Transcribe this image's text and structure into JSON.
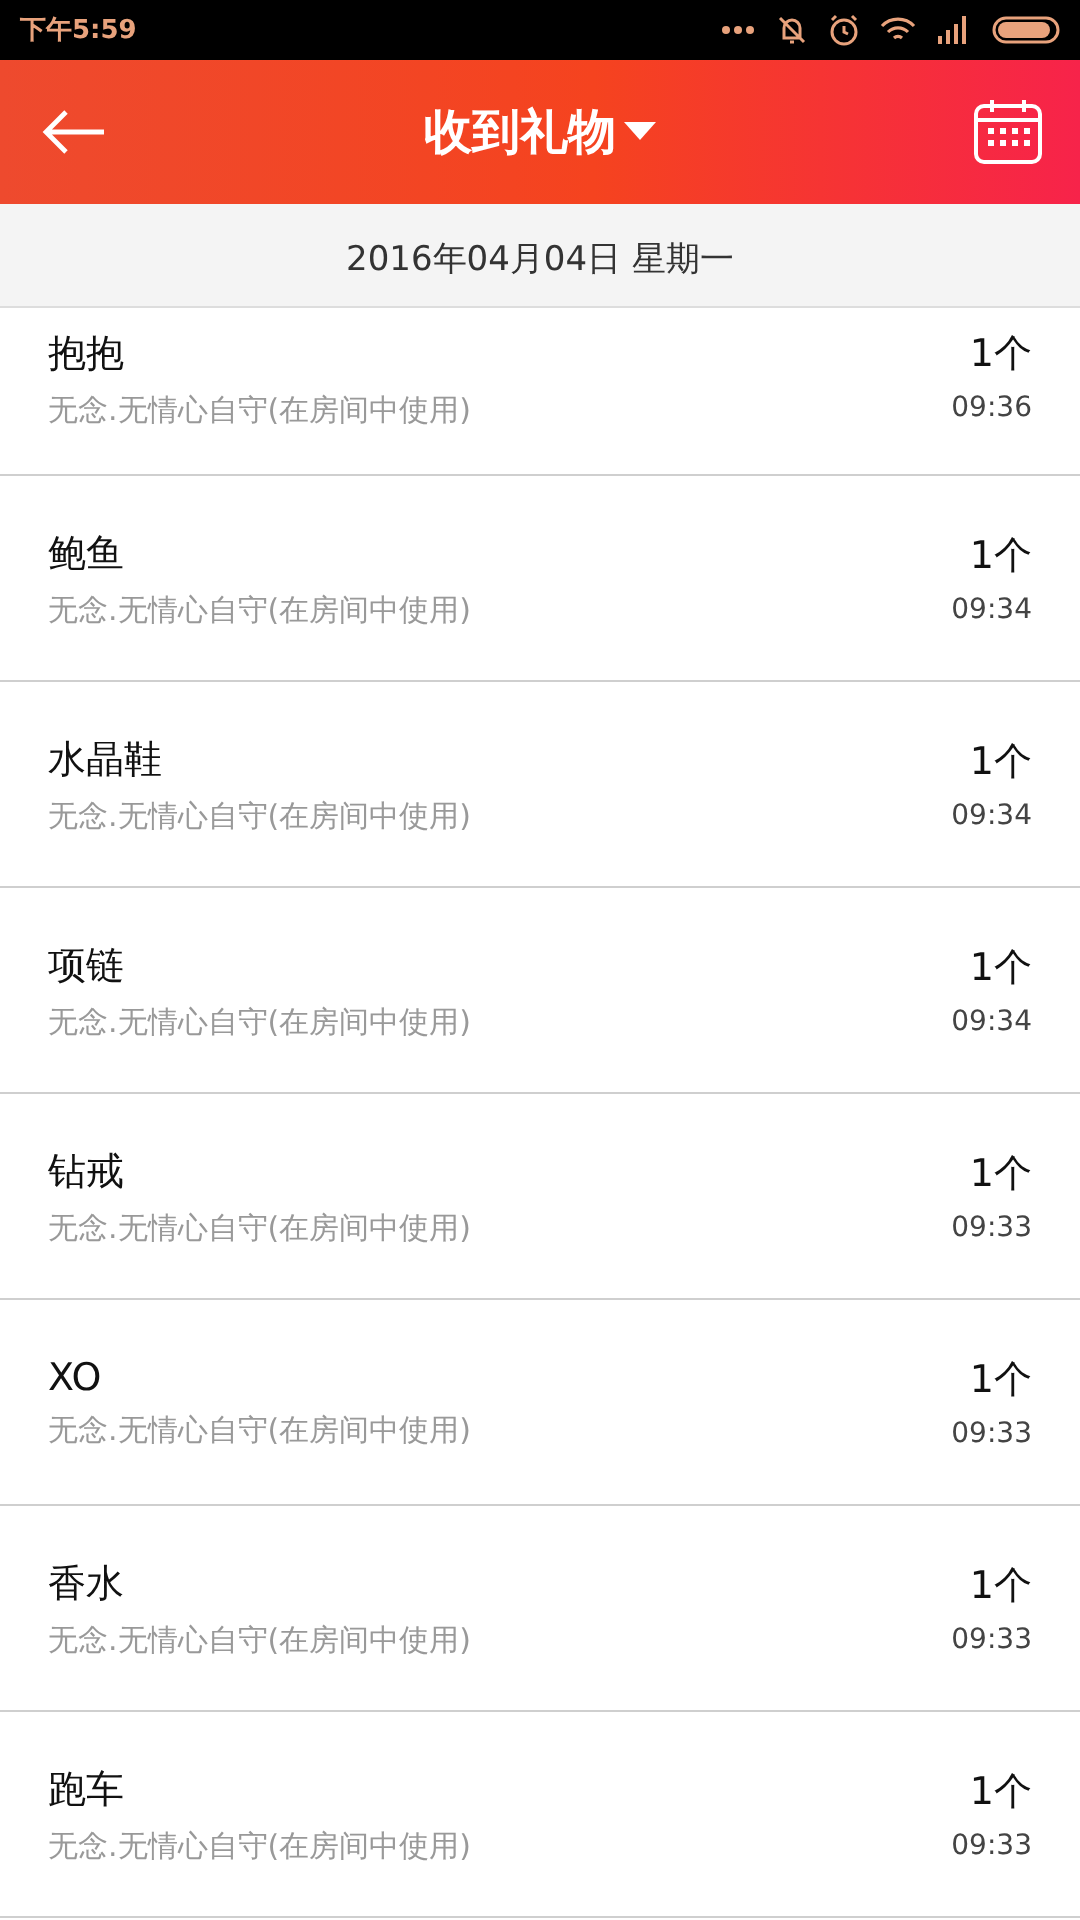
{
  "status_bar": {
    "time": "下午5:59"
  },
  "toolbar": {
    "title": "收到礼物"
  },
  "date_header": "2016年04月04日 星期一",
  "gifts": [
    {
      "name": "抱抱",
      "description": "无念.无情心自守(在房间中使用)",
      "count": "1个",
      "time": "09:36"
    },
    {
      "name": "鲍鱼",
      "description": "无念.无情心自守(在房间中使用)",
      "count": "1个",
      "time": "09:34"
    },
    {
      "name": "水晶鞋",
      "description": "无念.无情心自守(在房间中使用)",
      "count": "1个",
      "time": "09:34"
    },
    {
      "name": "项链",
      "description": "无念.无情心自守(在房间中使用)",
      "count": "1个",
      "time": "09:34"
    },
    {
      "name": "钻戒",
      "description": "无念.无情心自守(在房间中使用)",
      "count": "1个",
      "time": "09:33"
    },
    {
      "name": "XO",
      "description": "无念.无情心自守(在房间中使用)",
      "count": "1个",
      "time": "09:33"
    },
    {
      "name": "香水",
      "description": "无念.无情心自守(在房间中使用)",
      "count": "1个",
      "time": "09:33"
    },
    {
      "name": "跑车",
      "description": "无念.无情心自守(在房间中使用)",
      "count": "1个",
      "time": "09:33"
    }
  ]
}
